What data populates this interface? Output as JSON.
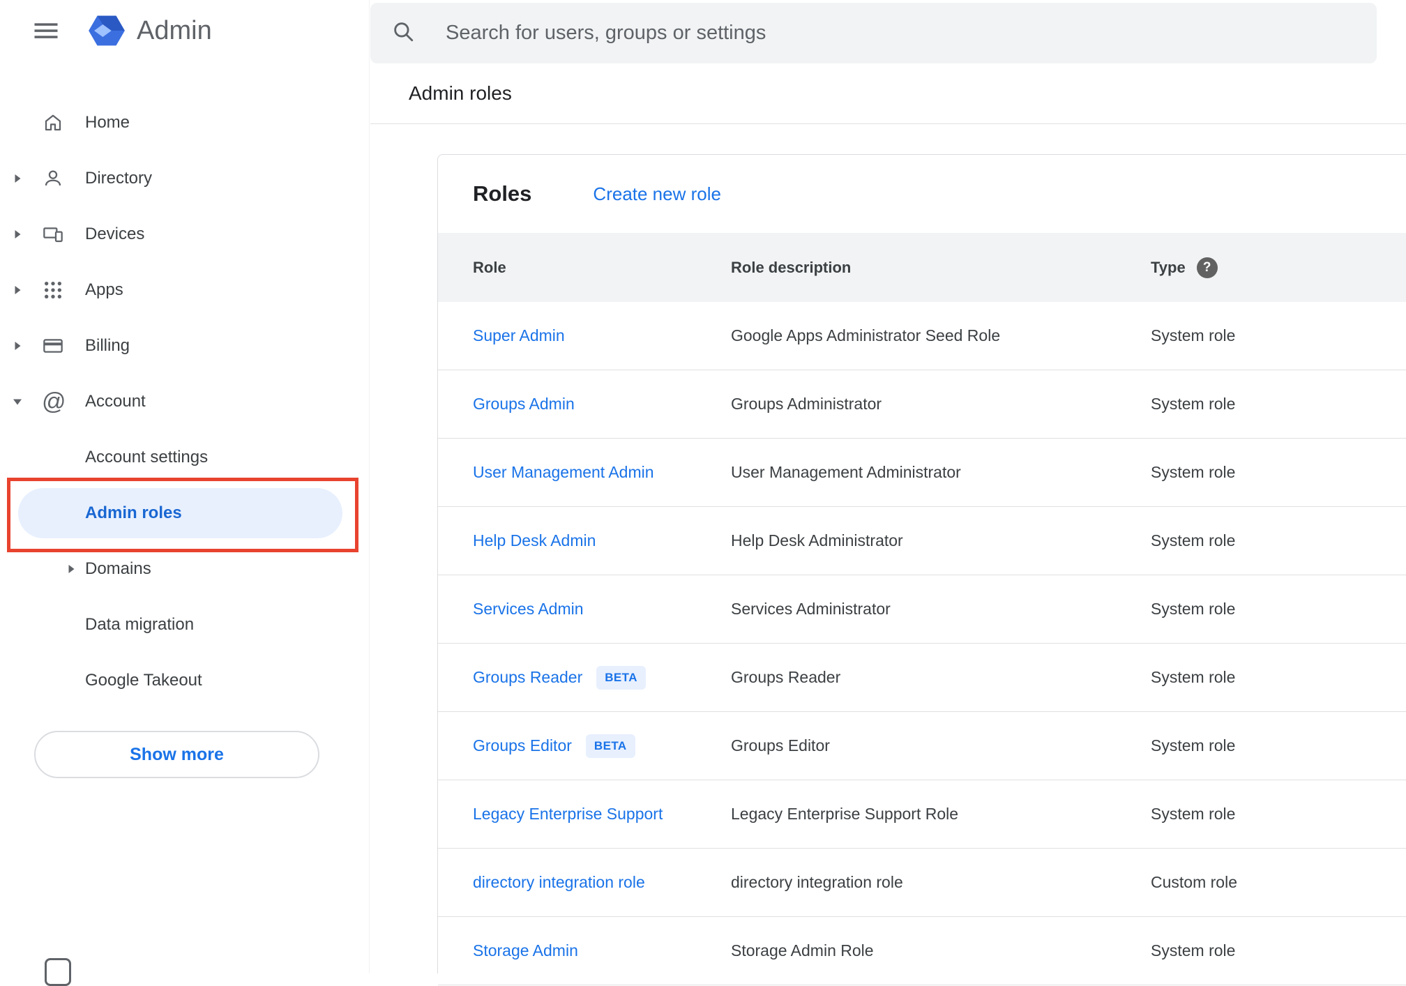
{
  "app": {
    "title": "Admin"
  },
  "search": {
    "placeholder": "Search for users, groups or settings"
  },
  "page": {
    "breadcrumb": "Admin roles"
  },
  "sidebar": {
    "items": [
      {
        "label": "Home"
      },
      {
        "label": "Directory"
      },
      {
        "label": "Devices"
      },
      {
        "label": "Apps"
      },
      {
        "label": "Billing"
      },
      {
        "label": "Account"
      }
    ],
    "account_children": [
      {
        "label": "Account settings"
      },
      {
        "label": "Admin roles"
      },
      {
        "label": "Domains"
      },
      {
        "label": "Data migration"
      },
      {
        "label": "Google Takeout"
      }
    ],
    "show_more": "Show more"
  },
  "roles": {
    "title": "Roles",
    "create_link": "Create new role",
    "headers": {
      "role": "Role",
      "description": "Role description",
      "type": "Type"
    },
    "beta_label": "BETA",
    "help_glyph": "?",
    "rows": [
      {
        "role": "Super Admin",
        "description": "Google Apps Administrator Seed Role",
        "type": "System role"
      },
      {
        "role": "Groups Admin",
        "description": "Groups Administrator",
        "type": "System role"
      },
      {
        "role": "User Management Admin",
        "description": "User Management Administrator",
        "type": "System role"
      },
      {
        "role": "Help Desk Admin",
        "description": "Help Desk Administrator",
        "type": "System role"
      },
      {
        "role": "Services Admin",
        "description": "Services Administrator",
        "type": "System role"
      },
      {
        "role": "Groups Reader",
        "description": "Groups Reader",
        "type": "System role"
      },
      {
        "role": "Groups Editor",
        "description": "Groups Editor",
        "type": "System role"
      },
      {
        "role": "Legacy Enterprise Support",
        "description": "Legacy Enterprise Support Role",
        "type": "System role"
      },
      {
        "role": "directory integration role",
        "description": "directory integration role",
        "type": "Custom role"
      },
      {
        "role": "Storage Admin",
        "description": "Storage Admin Role",
        "type": "System role"
      }
    ]
  },
  "icons": {
    "menu": "hamburger",
    "search": "magnifier",
    "help": "question-circle",
    "account": "@",
    "expand_collapsed": "right-triangle",
    "expand_expanded": "down-triangle"
  },
  "colors": {
    "accent_blue": "#1a73e8",
    "selected_item_bg": "#e8f0fe",
    "selected_item_text": "#1967d2",
    "annotation_red": "#e8432f",
    "searchbar_bg": "#f1f3f4",
    "table_header_bg": "#f1f3f4",
    "divider": "#e0e0e0",
    "icon_gray": "#5f6368"
  }
}
